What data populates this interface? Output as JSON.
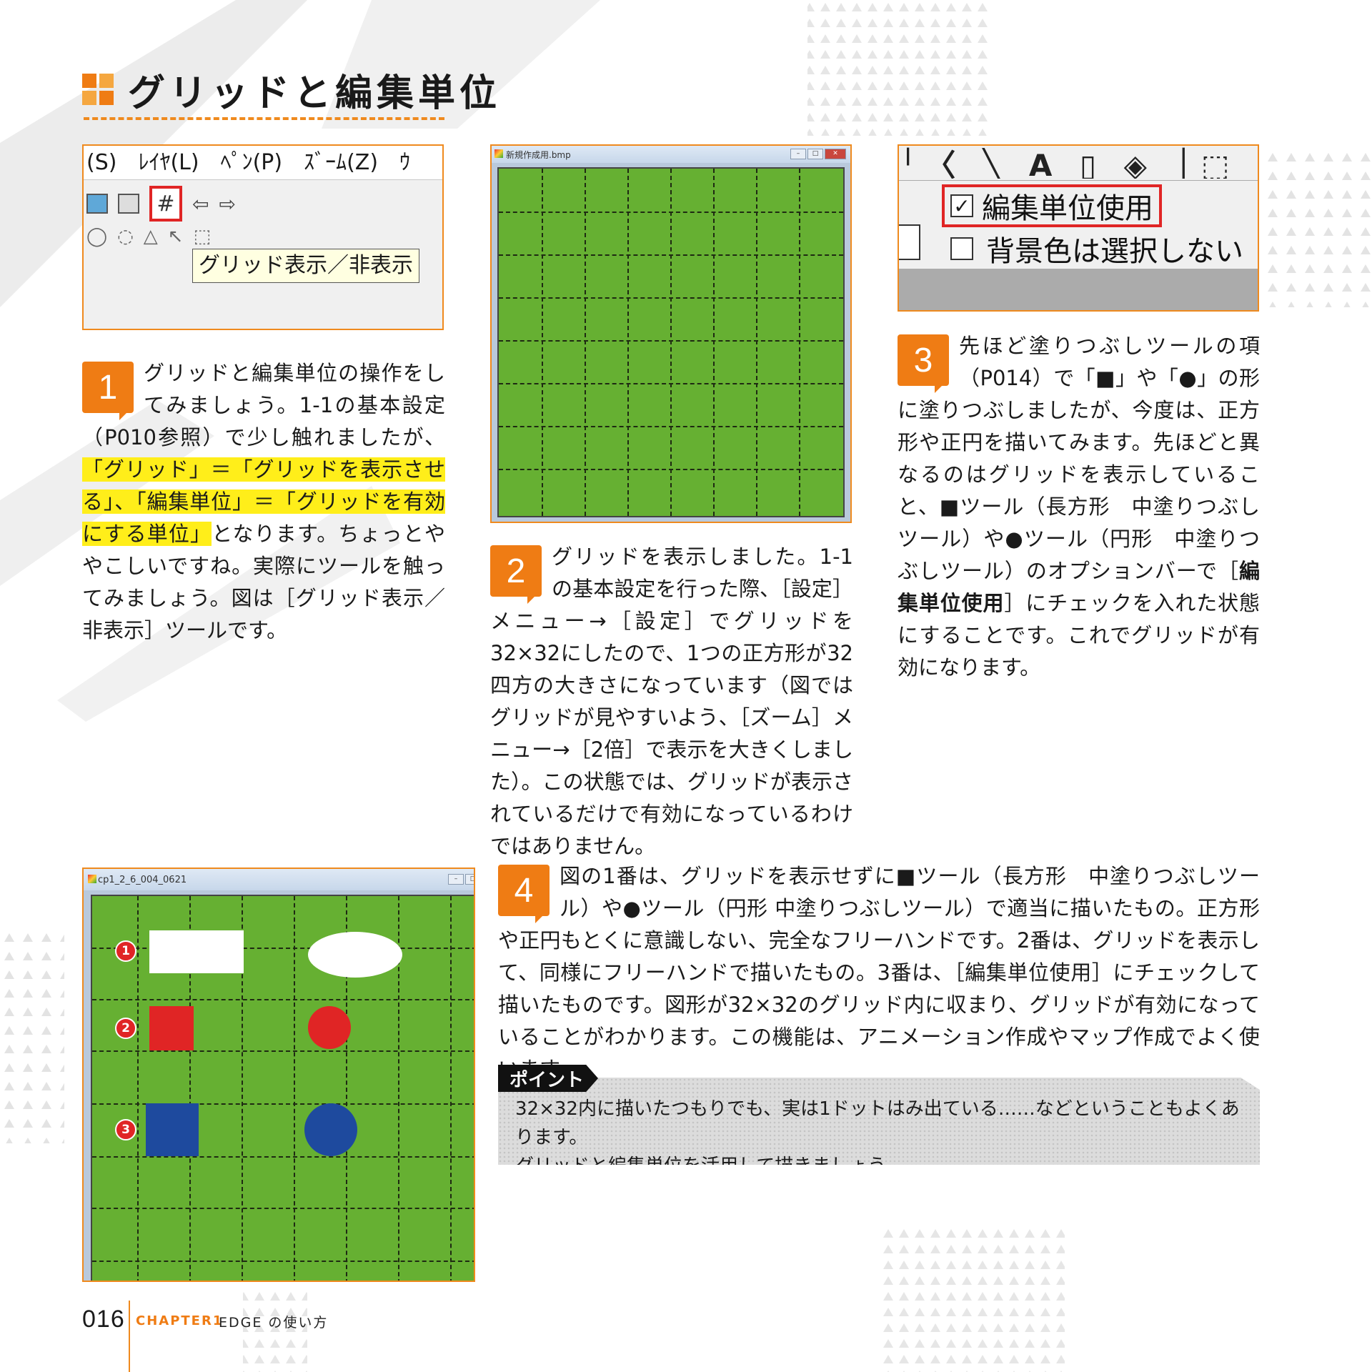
{
  "title": "グリッドと編集単位",
  "colors": {
    "accent": "#ef7c14",
    "grid_green": "#66b032",
    "highlight": "#ffee1a",
    "red": "#e02525",
    "blue": "#1e4a9e"
  },
  "shot1": {
    "menu": "(S)　ﾚｲﾔ(L)　ﾍﾟﾝ(P)　ｽﾞｰﾑ(Z)　ｳ",
    "tooltip": "グリッド表示／非表示"
  },
  "shot2": {
    "window_title": "新規作成用.bmp"
  },
  "shot3": {
    "toolbar_glyphs": "╵〈 ╲ A ▯ ◈ │⬚",
    "checkbox1": "編集単位使用",
    "checkbox2": "背景色は選択しない"
  },
  "shot4": {
    "window_title": "cp1_2_6_004_0621",
    "markers": [
      "1",
      "2",
      "3"
    ]
  },
  "step1": {
    "number": "1",
    "pre": "グリッドと編集単位の操作をしてみましょう。1-1の基本設定（P010参照）で少し触れましたが、",
    "highlight": "「グリッド」＝「グリッドを表示させる」、「編集単位」＝「グリッドを有効にする単位」",
    "post": "となります。ちょっとややこしいですね。実際にツールを触ってみましょう。図は［グリッド表示／非表示］ツールです。"
  },
  "step2": {
    "number": "2",
    "text": "グリッドを表示しました。1-1の基本設定を行った際、［設定］メニュー→［設定］でグリッドを32×32にしたので、1つの正方形が32四方の大きさになっています（図ではグリッドが見やすいよう、［ズーム］メニュー→［2倍］で表示を大きくしました）。この状態では、グリッドが表示されているだけで有効になっているわけではありません。"
  },
  "step3": {
    "number": "3",
    "pre": "先ほど塗りつぶしツールの項（P014）で「■」や「●」の形に塗りつぶしましたが、今度は、正方形や正円を描いてみます。先ほどと異なるのはグリッドを表示していること、■ツール（長方形　中塗りつぶしツール）や●ツール（円形　中塗りつぶしツール）のオプションバーで［",
    "bold": "編集単位使用",
    "post": "］にチェックを入れた状態にすることです。これでグリッドが有効になります。"
  },
  "step4": {
    "number": "4",
    "text": "図の1番は、グリッドを表示せずに■ツール（長方形　中塗りつぶしツール）や●ツール（円形 中塗りつぶしツール）で適当に描いたもの。正方形や正円もとくに意識しない、完全なフリーハンドです。2番は、グリッドを表示して、同様にフリーハンドで描いたもの。3番は、［編集単位使用］にチェックして描いたものです。図形が32×32のグリッド内に収まり、グリッドが有効になっていることがわかります。この機能は、アニメーション作成やマップ作成でよく使います。"
  },
  "point": {
    "label": "ポイント",
    "line1": "32×32内に描いたつもりでも、実は1ドットはみ出ている……などということもよくあります。",
    "line2": "グリッドと編集単位を活用して描きましょう。"
  },
  "footer": {
    "page": "016",
    "chapter": "CHAPTER1",
    "subtitle": "EDGE の使い方"
  }
}
